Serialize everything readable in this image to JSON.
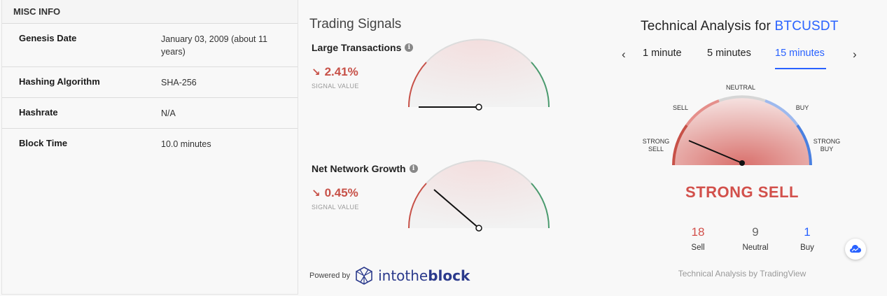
{
  "misc": {
    "title": "MISC INFO",
    "rows": [
      {
        "label": "Genesis Date",
        "value": "January 03, 2009 (about 11 years)"
      },
      {
        "label": "Hashing Algorithm",
        "value": "SHA-256"
      },
      {
        "label": "Hashrate",
        "value": "N/A"
      },
      {
        "label": "Block Time",
        "value": "10.0 minutes"
      }
    ]
  },
  "signals": {
    "title": "Trading Signals",
    "items": [
      {
        "name": "Large Transactions",
        "value": "2.41%",
        "sub": "SIGNAL VALUE"
      },
      {
        "name": "Net Network Growth",
        "value": "0.45%",
        "sub": "SIGNAL VALUE"
      }
    ],
    "powered_by": "Powered by",
    "logo_pre": "intothe",
    "logo_bold": "block"
  },
  "ta": {
    "title_prefix": "Technical Analysis for",
    "symbol": "BTCUSDT",
    "tabs": [
      "1 minute",
      "5 minutes",
      "15 minutes"
    ],
    "active_tab": "15 minutes",
    "labels": {
      "neutral": "NEUTRAL",
      "sell": "SELL",
      "buy": "BUY",
      "strong_sell_1": "STRONG",
      "strong_sell_2": "SELL",
      "strong_buy_1": "STRONG",
      "strong_buy_2": "BUY"
    },
    "summary": "STRONG SELL",
    "counts": [
      {
        "num": "18",
        "label": "Sell",
        "color": "#d2504b"
      },
      {
        "num": "9",
        "label": "Neutral",
        "color": "#666666"
      },
      {
        "num": "1",
        "label": "Buy",
        "color": "#2962ff"
      }
    ],
    "credit": "Technical Analysis by TradingView"
  },
  "colors": {
    "sell": "#c75148",
    "buy": "#4a9a6e",
    "accent": "#2962ff"
  }
}
